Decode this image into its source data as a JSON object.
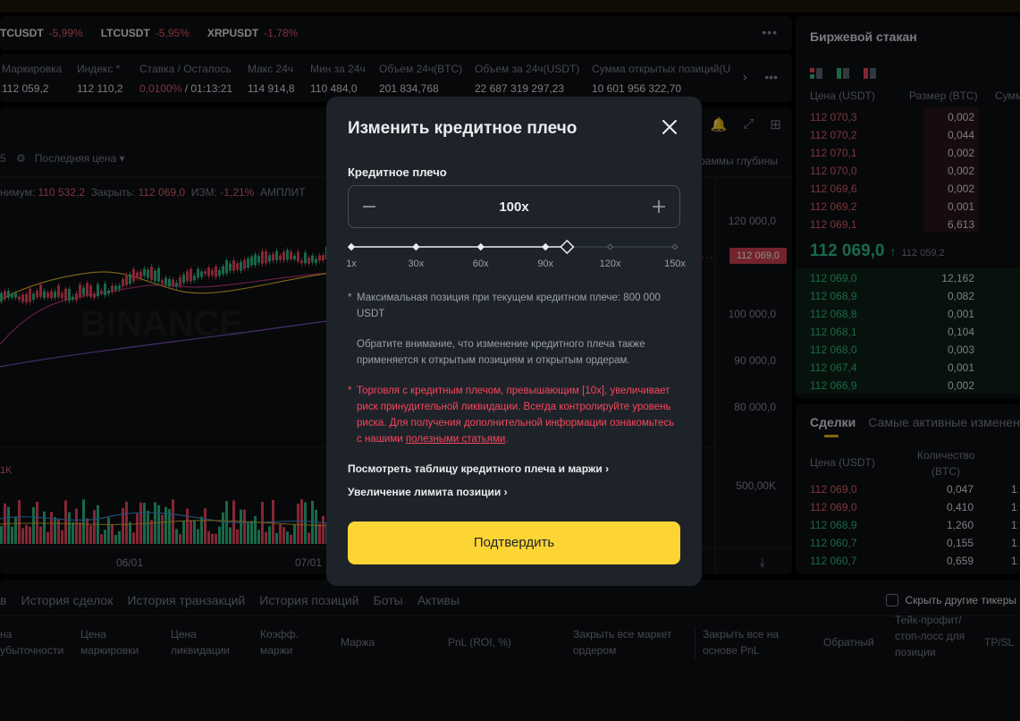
{
  "tickers": [
    {
      "symbol": "TCUSDT",
      "change": "-5,99%"
    },
    {
      "symbol": "LTCUSDT",
      "change": "-5,95%"
    },
    {
      "symbol": "XRPUSDT",
      "change": "-1,78%"
    }
  ],
  "stats": [
    {
      "label": "Маркировка",
      "value": "112 059,2"
    },
    {
      "label": "Индекс",
      "value": "112 110,2"
    },
    {
      "label": "Ставка / Осталось",
      "value_rate": "0,0100%",
      "value_rest": " / 01:13:21"
    },
    {
      "label": "Макс 24ч",
      "value": "114 914,8"
    },
    {
      "label": "Мин за 24ч",
      "value": "110 484,0"
    },
    {
      "label": "Объем 24ч(BTC)",
      "value": "201 834,768"
    },
    {
      "label": "Объем за 24ч(USDT)",
      "value": "22 687 319 297,23"
    },
    {
      "label": "Сумма открытых позиций(U",
      "value": "10 601 956 322,70"
    }
  ],
  "chart": {
    "price_type": "Последняя цена",
    "depth_label": "раммы глубины",
    "ohlc": {
      "min_label": "нимум:",
      "min": "110 532,2",
      "close_label": "Закрыть:",
      "close": "112 069,0",
      "chg_label": "ИЗМ:",
      "chg": "-1,21%",
      "ampl_label": "АМПЛИТ"
    },
    "y_ticks": [
      "120 000,0",
      "100 000,0",
      "90 000,0",
      "80 000,0",
      "500,00K"
    ],
    "price_tag": "112 069,0",
    "x_ticks": [
      "06/01",
      "07/01"
    ],
    "vol_label": "1K",
    "watermark": "BINANCE"
  },
  "bottom": {
    "tabs": [
      "в",
      "История сделок",
      "История транзакций",
      "История позиций",
      "Боты",
      "Активы"
    ],
    "hide_other": "Скрыть другие тикеры",
    "columns": [
      {
        "l1": "на",
        "l2": "убыточности"
      },
      {
        "l1": "Цена",
        "l2": "маркировки"
      },
      {
        "l1": "Цена",
        "l2": "ликвидации"
      },
      {
        "l1": "Коэфф.",
        "l2": "маржи"
      },
      {
        "l1": "Маржа",
        "l2": ""
      },
      {
        "l1": "PnL (ROI, %)",
        "l2": ""
      },
      {
        "l1": "Закрыть все маркет",
        "l2": "ордером"
      },
      {
        "l1": "Закрыть все на",
        "l2": "основе PnL"
      },
      {
        "l1": "Обратный",
        "l2": ""
      },
      {
        "l1": "Тейк-профит/",
        "l2": "стоп-лосс для",
        "l3": "позиции"
      },
      {
        "l1": "TP/SL",
        "l2": ""
      }
    ]
  },
  "orderbook": {
    "title": "Биржевой стакан",
    "head": {
      "price": "Цена (USDT)",
      "size": "Размер (BTC)",
      "sum": "Сумм"
    },
    "asks": [
      {
        "price": "112 070,3",
        "size": "0,002"
      },
      {
        "price": "112 070,2",
        "size": "0,044"
      },
      {
        "price": "112 070,1",
        "size": "0,002"
      },
      {
        "price": "112 070,0",
        "size": "0,002"
      },
      {
        "price": "112 069,6",
        "size": "0,002"
      },
      {
        "price": "112 069,2",
        "size": "0,001"
      },
      {
        "price": "112 069,1",
        "size": "6,613"
      }
    ],
    "mid": {
      "price": "112 069,0",
      "arrow": "↑",
      "mark": "112 059,2"
    },
    "bids": [
      {
        "price": "112 069,0",
        "size": "12,162"
      },
      {
        "price": "112 068,9",
        "size": "0,082"
      },
      {
        "price": "112 068,8",
        "size": "0,001"
      },
      {
        "price": "112 068,1",
        "size": "0,104"
      },
      {
        "price": "112 068,0",
        "size": "0,003"
      },
      {
        "price": "112 067,4",
        "size": "0,001"
      },
      {
        "price": "112 066,9",
        "size": "0,002"
      }
    ]
  },
  "trades": {
    "tab_active": "Сделки",
    "tab_other": "Самые активные изменен",
    "head_price": "Цена (USDT)",
    "head_qty_1": "Количество",
    "head_qty_2": "(BTC)",
    "rows": [
      {
        "price": "112 069,0",
        "qty": "0,047",
        "time": "1:",
        "side": "sell"
      },
      {
        "price": "112 069,0",
        "qty": "0,410",
        "time": "1:",
        "side": "sell"
      },
      {
        "price": "112 068,9",
        "qty": "1,260",
        "time": "1:",
        "side": "buy"
      },
      {
        "price": "112 060,7",
        "qty": "0,155",
        "time": "1:",
        "side": "buy"
      },
      {
        "price": "112 060,7",
        "qty": "0,659",
        "time": "1:",
        "side": "buy"
      }
    ]
  },
  "modal": {
    "title": "Изменить кредитное плечо",
    "leverage_label": "Кредитное плечо",
    "leverage_value": "100x",
    "leverage_current": 100,
    "leverage_max": 150,
    "slider_ticks": [
      "1x",
      "30x",
      "60x",
      "90x",
      "120x",
      "150x"
    ],
    "note_max_star": "*",
    "note_max": "Максимальная позиция при текущем кредитном плече: 800 000 USDT",
    "note_changes": "Обратите внимание, что изменение кредитного плеча также применяется к открытым позициям и открытым ордерам.",
    "warning_star": "*",
    "warning_text": "Торговля с кредитным плечом, превышающим [10x], увеличивает риск принудительной ликвидации. Всегда контролируйте уровень риска. Для получения дополнительной информации ознакомьтесь с нашими ",
    "warning_link": "полезными статьями",
    "warning_end": ".",
    "link_table": "Посмотреть таблицу кредитного плеча и маржи",
    "link_limit": "Увеличение лимита позиции",
    "confirm": "Подтвердить"
  },
  "colors": {
    "accent": "#fcd535",
    "up": "#2ebd85",
    "down": "#f6465d",
    "modal_bg": "#1e2329"
  }
}
